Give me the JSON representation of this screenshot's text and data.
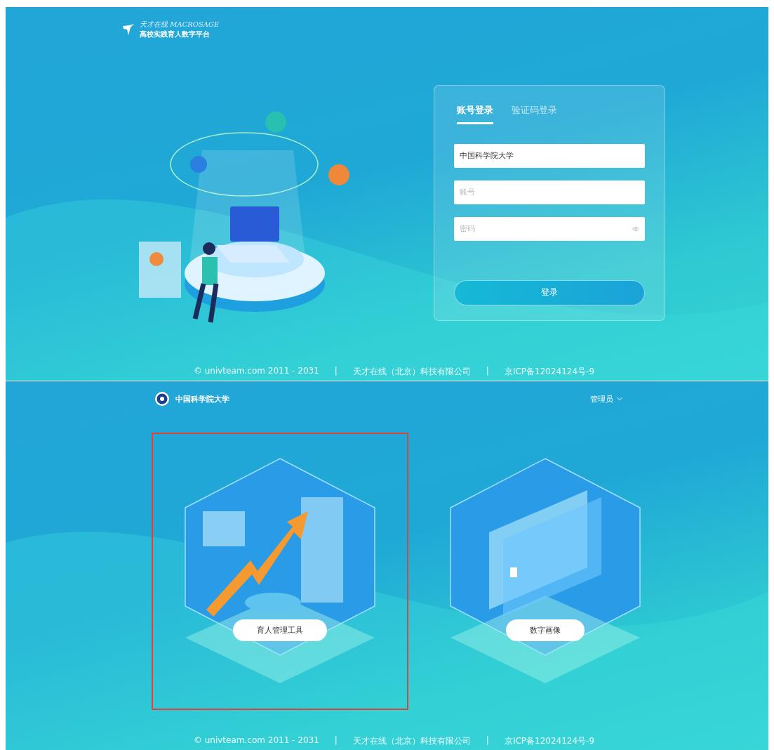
{
  "login_screen": {
    "logo": {
      "brand": "天才在线 MACROSAGE",
      "title": "高校实践育人数字平台"
    },
    "tabs": [
      {
        "label": "账号登录",
        "selected": true
      },
      {
        "label": "验证码登录",
        "selected": false
      }
    ],
    "fields": [
      {
        "kind": "value",
        "value": "中国科学院大学"
      },
      {
        "kind": "placeholder",
        "placeholder": "账号"
      },
      {
        "kind": "password",
        "placeholder": "密码"
      }
    ],
    "submit": "登录",
    "footer": [
      "© univteam.com 2011 - 2031",
      "|",
      "天才在线（北京）科技有限公司",
      "|",
      "京ICP备12024124号-9"
    ]
  },
  "portal_screen": {
    "school": "中国科学院大学",
    "user_menu": "管理员",
    "cards": [
      {
        "label": "育人管理工具",
        "selected": true
      },
      {
        "label": "数字画像",
        "selected": false
      }
    ],
    "footer": [
      "© univteam.com 2011 - 2031",
      "|",
      "天才在线（北京）科技有限公司",
      "|",
      "京ICP备12024124号-9"
    ]
  }
}
